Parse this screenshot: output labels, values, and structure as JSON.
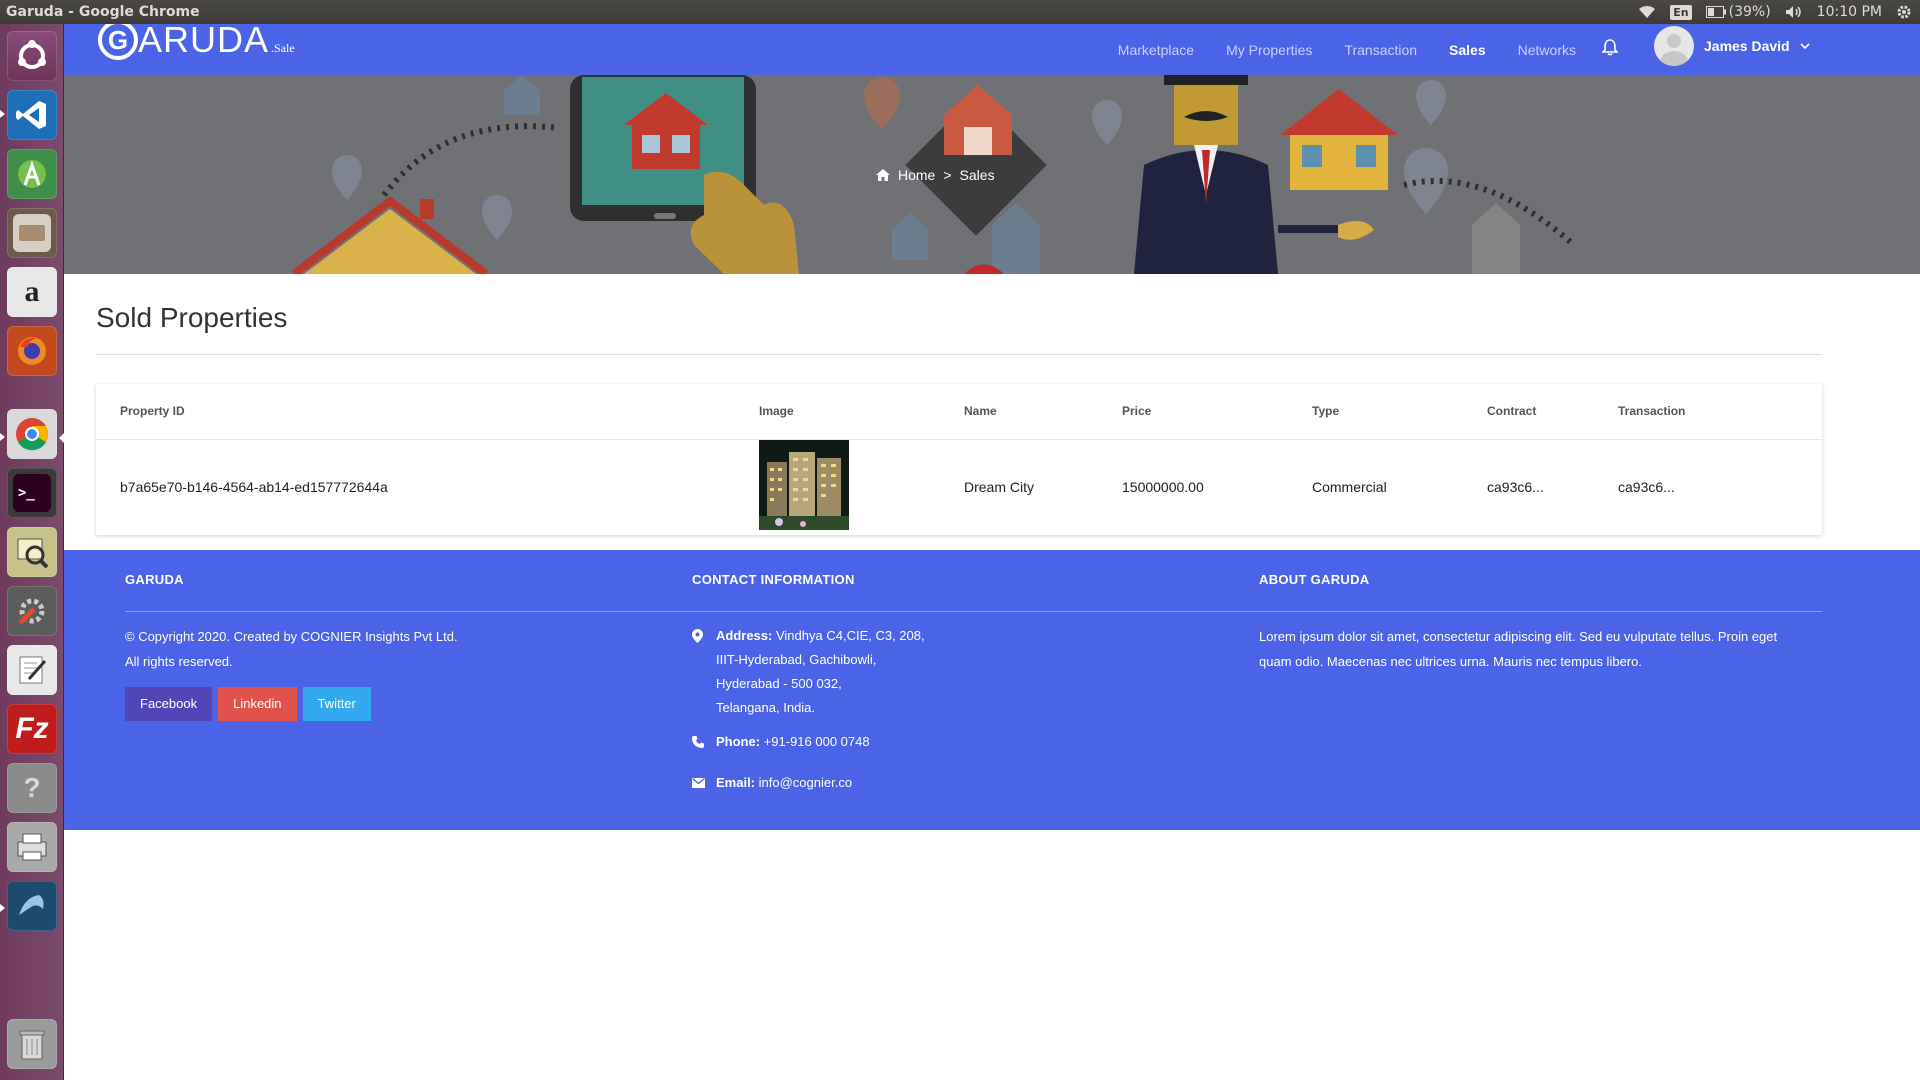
{
  "os": {
    "window_title": "Garuda - Google Chrome",
    "lang": "En",
    "battery": "(39%)",
    "clock": "10:10 PM"
  },
  "launcher": {
    "apps": [
      "ubuntu-dash-icon",
      "vscode-icon",
      "android-studio-icon",
      "files-icon",
      "amazon-icon",
      "firefox-icon",
      "chrome-icon",
      "terminal-icon",
      "image-viewer-icon",
      "system-settings-icon",
      "text-editor-icon",
      "filezilla-icon",
      "help-icon",
      "printer-icon",
      "mysql-workbench-icon",
      "trash-icon"
    ]
  },
  "nav": {
    "logo_letter": "G",
    "logo_word": "ARUDA",
    "logo_suffix": ".Sale",
    "links": [
      "Marketplace",
      "My Properties",
      "Transaction",
      "Sales",
      "Networks"
    ],
    "active": "Sales",
    "user_name": "James David"
  },
  "breadcrumb": {
    "home": "Home",
    "separator": ">",
    "current": "Sales"
  },
  "page": {
    "title": "Sold Properties"
  },
  "table": {
    "columns": [
      "Property ID",
      "Image",
      "Name",
      "Price",
      "Type",
      "Contract",
      "Transaction"
    ],
    "rows": [
      {
        "property_id": "b7a65e70-b146-4564-ab14-ed157772644a",
        "name": "Dream City",
        "price": "15000000.00",
        "type": "Commercial",
        "contract": "ca93c6...",
        "transaction": "ca93c6..."
      }
    ]
  },
  "footer": {
    "col1": {
      "heading": "GARUDA",
      "copyright": "© Copyright 2020. Created by COGNIER Insights Pvt Ltd.",
      "rights": "All rights reserved.",
      "buttons": [
        "Facebook",
        "Linkedin",
        "Twitter"
      ]
    },
    "col2": {
      "heading": "CONTACT INFORMATION",
      "address_label": "Address:",
      "address_lines": [
        "Vindhya C4,CIE, C3, 208,",
        "IIIT-Hyderabad, Gachibowli,",
        "Hyderabad - 500 032,",
        "Telangana, India."
      ],
      "phone_label": "Phone:",
      "phone": "+91-916 000 0748",
      "email_label": "Email:",
      "email": "info@cognier.co"
    },
    "col3": {
      "heading": "ABOUT GARUDA",
      "text": "Lorem ipsum dolor sit amet, consectetur adipiscing elit. Sed eu vulputate tellus. Proin eget quam odio. Maecenas nec ultrices urna. Mauris nec tempus libero."
    }
  },
  "colors": {
    "brand": "#4a63e7",
    "facebook": "#5046b8",
    "linkedin": "#e0524a",
    "twitter": "#34a8ee"
  }
}
